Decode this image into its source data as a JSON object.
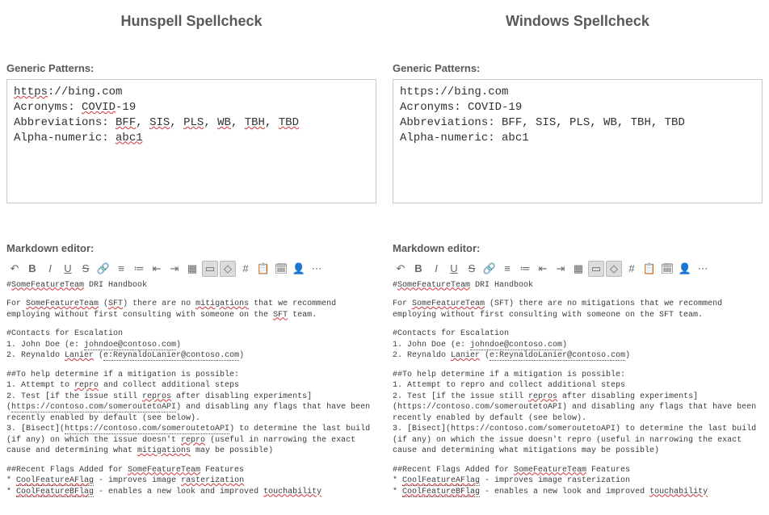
{
  "left": {
    "title": "Hunspell Spellcheck",
    "generic_label": "Generic Patterns:",
    "box": {
      "url_plain": "https",
      "url_rest": "://bing.com",
      "acronyms_label": "Acronyms: ",
      "acronym_err": "COVID",
      "acronym_tail": "-19",
      "abbrev_label": "Abbreviations: ",
      "abbrev_sep": ", ",
      "ab1": "BFF",
      "ab2": "SIS",
      "ab3": "PLS",
      "ab4": "WB",
      "ab5": "TBH",
      "ab6": "TBD",
      "alpha_label": "Alpha-numeric: ",
      "alpha_err": "abc1"
    },
    "md_label": "Markdown editor:",
    "md": {
      "l1a": "#",
      "l1b": "SomeFeatureTeam",
      "l1c": " DRI Handbook",
      "p1a": "For ",
      "p1b": "SomeFeatureTeam",
      "p1c": " (",
      "p1d": "SFT",
      "p1e": ") there are no ",
      "p1f": "mitigations",
      "p1g": " that we recommend employing without first consulting with someone on the ",
      "p1h": "SFT",
      "p1i": " team.",
      "c_head": "#Contacts for Escalation",
      "c1a": "1. John Doe (e: ",
      "c1b": "johndoe@contoso.com",
      "c1c": ")",
      "c2a": "2. Reynaldo ",
      "c2b": "Lanier",
      "c2c": " (",
      "c2d": "e:ReynaldoLanier@contoso.com",
      "c2e": ")",
      "h_head": "##To help determine if a mitigation is possible:",
      "h1a": "1. Attempt to ",
      "h1b": "repro",
      "h1c": " and collect additional steps",
      "h2a": "2. Test [if the issue still ",
      "h2b": "repros",
      "h2c": " after disabling experiments](",
      "h2d": "https://contoso.com/someroutetoAPI",
      "h2e": ") and disabling any flags that have been recently enabled by default (see below).",
      "h3a": "3. [Bisect](",
      "h3b": "https://contoso.com/someroutetoAPI",
      "h3c": ") to determine the last build (if any) on which the issue doesn't ",
      "h3d": "repro",
      "h3e": " (useful in narrowing the exact cause and determining what ",
      "h3f": "mitigations",
      "h3g": " may be possible)",
      "f_head_a": "##Recent Flags Added for ",
      "f_head_b": "SomeFeatureTeam",
      "f_head_c": " Features",
      "f1a": "* ",
      "f1b": "CoolFeatureAFlag",
      "f1c": " - improves image ",
      "f1d": "rasterization",
      "f2a": "* ",
      "f2b": "CoolFeatureBFlag",
      "f2c": " - enables a new look and improved ",
      "f2d": "touchability"
    }
  },
  "right": {
    "title": "Windows Spellcheck",
    "generic_label": "Generic Patterns:",
    "box": {
      "url": "https://bing.com",
      "acronyms": "Acronyms: COVID-19",
      "abbrev": "Abbreviations: BFF, SIS, PLS, WB, TBH, TBD",
      "alpha": "Alpha-numeric: abc1"
    },
    "md_label": "Markdown editor:",
    "md": {
      "l1a": "#",
      "l1b": "SomeFeatureTeam",
      "l1c": " DRI Handbook",
      "p1": "For ",
      "p1b": "SomeFeatureTeam",
      "p1c": " (SFT) there are no mitigations that we recommend employing without first consulting with someone on the SFT team.",
      "c_head": "#Contacts for Escalation",
      "c1a": "1. John Doe (e: ",
      "c1b": "johndoe@contoso.com",
      "c1c": ")",
      "c2a": "2. Reynaldo ",
      "c2b": "Lanier",
      "c2c": " (",
      "c2d": "e:ReynaldoLanier@contoso.com",
      "c2e": ")",
      "h_head": "##To help determine if a mitigation is possible:",
      "h1": "1. Attempt to repro and collect additional steps",
      "h2": "2. Test [if the issue still ",
      "h2b": "repros",
      "h2c": " after disabling experiments](https://contoso.com/someroutetoAPI) and disabling any flags that have been recently enabled by default (see below).",
      "h3a": "3. [Bisect](https://contoso.com/someroutetoAPI) to determine the last build (if any) on which the issue doesn't repro (useful in narrowing the exact cause and determining what mitigations may be possible)",
      "f_head_a": "##Recent Flags Added for ",
      "f_head_b": "SomeFeatureTeam",
      "f_head_c": " Features",
      "f1a": "* ",
      "f1b": "CoolFeatureAFlag",
      "f1c": " - improves image rasterization",
      "f2a": "* ",
      "f2b": "CoolFeatureBFlag",
      "f2c": " - enables a new look and improved ",
      "f2d": "touchability"
    }
  },
  "toolbar_icons": [
    "undo",
    "bold",
    "italic",
    "underline",
    "strike",
    "link",
    "bullet-list",
    "number-list",
    "outdent",
    "indent",
    "table",
    "image",
    "code",
    "hash",
    "clipboard",
    "calendar",
    "user",
    "more"
  ]
}
